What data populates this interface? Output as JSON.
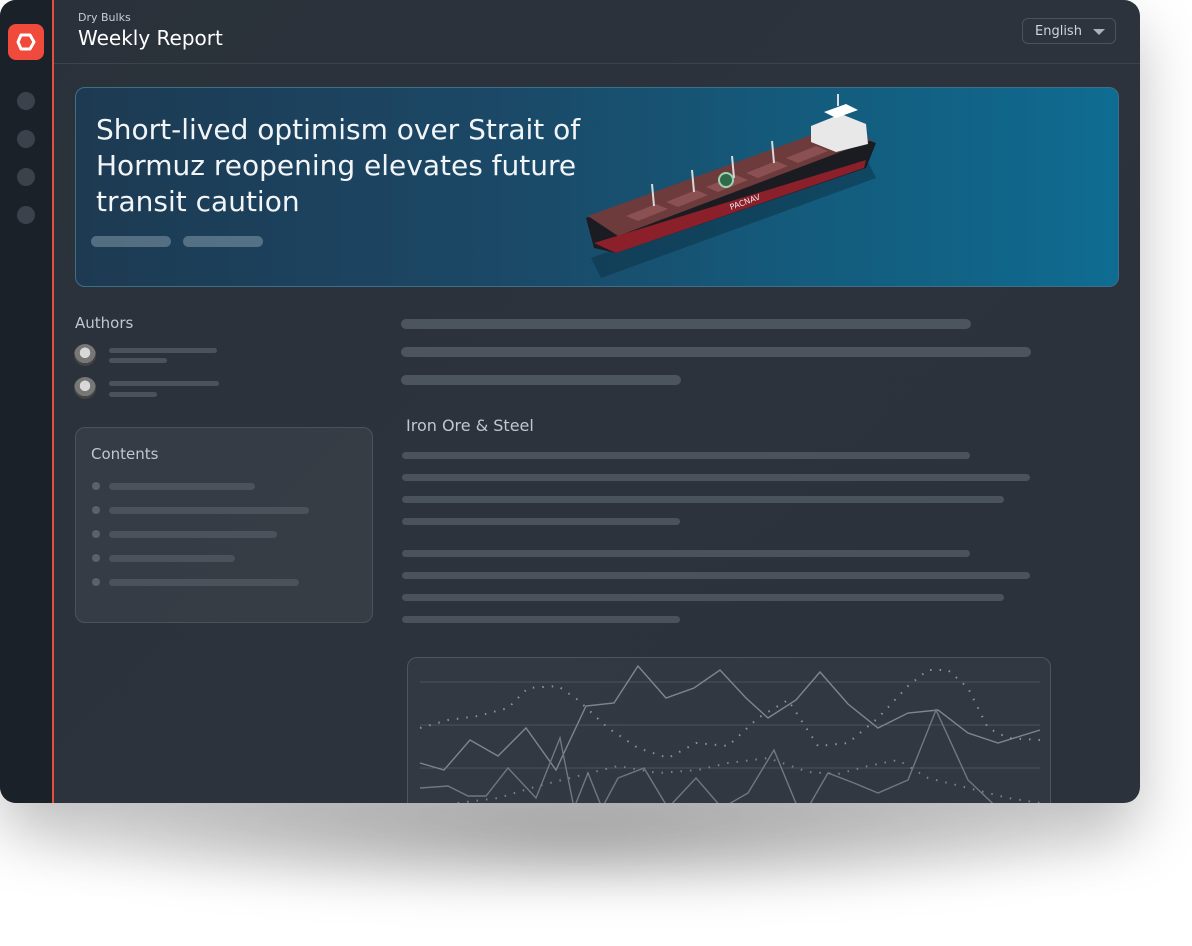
{
  "app": {
    "breadcrumb": "Dry Bulks",
    "title": "Weekly Report",
    "accent_color": "#ef4a3c",
    "logo_icon": "logo-icon"
  },
  "header": {
    "language_select": {
      "value": "English",
      "icon": "chevron-down-icon"
    }
  },
  "sidebar": {
    "nav_items": [
      "nav-item-1",
      "nav-item-2",
      "nav-item-3",
      "nav-item-4"
    ]
  },
  "hero": {
    "title": "Short-lived optimism over Strait of Hormuz reopening elevates future transit caution",
    "image": "bulk-carrier-ship-image",
    "ship_name": "PACNAV"
  },
  "authors": {
    "label": "Authors"
  },
  "contents": {
    "label": "Contents"
  },
  "article": {
    "section_heading": "Iron Ore & Steel"
  }
}
